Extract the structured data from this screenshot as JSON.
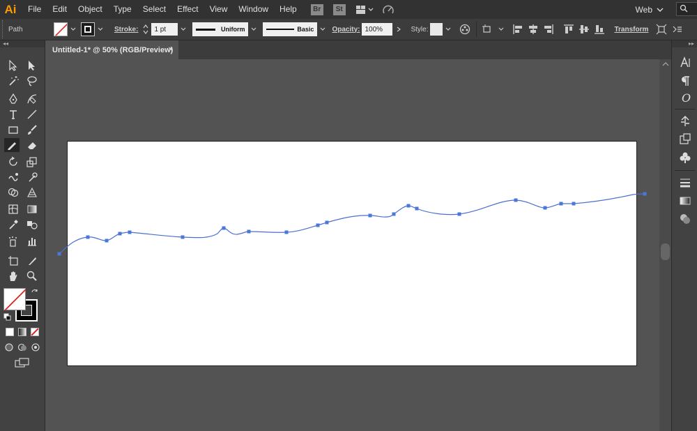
{
  "app": {
    "logo": "Ai"
  },
  "menu": {
    "items": [
      "File",
      "Edit",
      "Object",
      "Type",
      "Select",
      "Effect",
      "View",
      "Window",
      "Help"
    ],
    "bridge": "Br",
    "stock": "St",
    "workspace": "Web"
  },
  "control": {
    "selection": "Path",
    "stroke_label": "Stroke:",
    "stroke_weight": "1 pt",
    "profile": "Uniform",
    "brush": "Basic",
    "opacity_label": "Opacity:",
    "opacity": "100%",
    "style_label": "Style:",
    "transform": "Transform"
  },
  "document": {
    "tab_title": "Untitled-1* @ 50% (RGB/Preview)",
    "close": "×"
  },
  "colors": {
    "path_stroke": "#4a6fd0",
    "anchor": "#4a78d8",
    "artboard": "#ffffff",
    "accent": "#ff9a00"
  },
  "icons": {
    "tools": [
      "selection-tool",
      "direct-selection-tool",
      "magic-wand-tool",
      "lasso-tool",
      "pen-tool",
      "curvature-tool",
      "type-tool",
      "line-tool",
      "rectangle-tool",
      "paintbrush-tool",
      "pencil-tool",
      "eraser-tool",
      "rotate-tool",
      "scale-tool",
      "warp-tool",
      "puppet-warp-tool",
      "shape-builder-tool",
      "perspective-grid-tool",
      "mesh-tool",
      "gradient-tool",
      "eyedropper-tool",
      "blend-tool",
      "symbol-sprayer-tool",
      "column-graph-tool",
      "artboard-tool",
      "slice-tool",
      "hand-tool",
      "zoom-tool"
    ],
    "right_panel": [
      "character-icon",
      "paragraph-icon",
      "opentype-icon",
      "symbols-icon",
      "asset-export-icon",
      "libraries-icon",
      "stroke-panel-icon",
      "gradient-panel-icon",
      "transparency-icon"
    ]
  }
}
